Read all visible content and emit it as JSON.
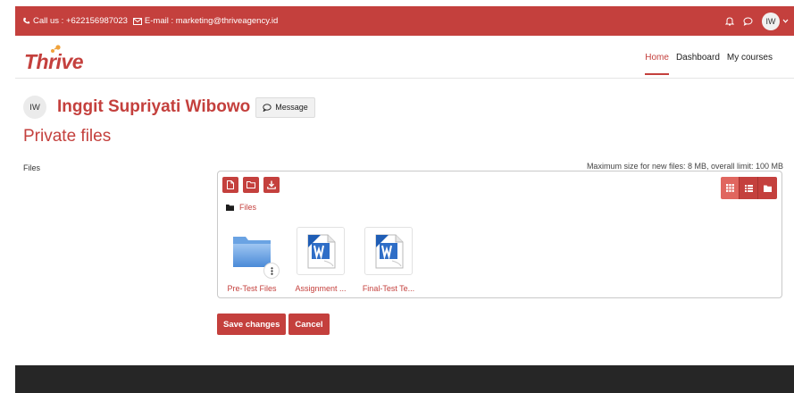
{
  "topbar": {
    "phone": "Call us : +622156987023",
    "email": "E-mail : marketing@thriveagency.id",
    "avatar_initials": "IW"
  },
  "brand": {
    "logo_text": "Thrive"
  },
  "nav": {
    "home": "Home",
    "dashboard": "Dashboard",
    "my_courses": "My courses"
  },
  "profile": {
    "initials": "IW",
    "name": "Inggit Supriyati Wibowo",
    "message_label": "Message"
  },
  "page": {
    "title": "Private files",
    "files_label": "Files",
    "limit_text": "Maximum size for new files: 8 MB, overall limit: 100 MB"
  },
  "filemanager": {
    "breadcrumb": "Files",
    "items": [
      {
        "name": "Pre-Test Files",
        "type": "folder"
      },
      {
        "name": "Assignment ...",
        "type": "word"
      },
      {
        "name": "Final-Test Te...",
        "type": "word"
      }
    ]
  },
  "actions": {
    "save": "Save changes",
    "cancel": "Cancel"
  },
  "colors": {
    "brand": "#c4403d",
    "footer": "#262626"
  },
  "icons": [
    "phone-icon",
    "mail-icon",
    "bell-icon",
    "chat-icon",
    "chevron-down-icon",
    "chat-bubble-icon",
    "new-file-icon",
    "new-folder-icon",
    "download-icon",
    "grid-view-icon",
    "list-view-icon",
    "tree-view-icon",
    "folder-icon",
    "more-icon"
  ]
}
